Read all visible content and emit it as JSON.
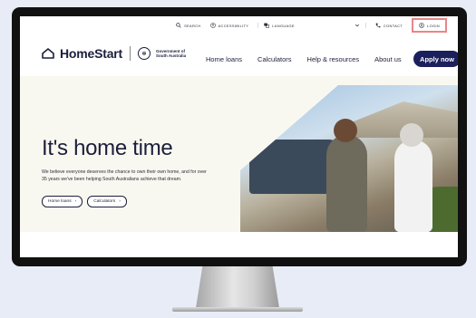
{
  "utility": {
    "search": "SEARCH",
    "accessibility": "ACCESSIBILITY",
    "language": "LANGUAGE",
    "contact": "CONTACT",
    "login": "LOGIN"
  },
  "brand": {
    "name": "HomeStart",
    "gov_line1": "Government of",
    "gov_line2": "South Australia"
  },
  "nav": {
    "items": [
      "Home loans",
      "Calculators",
      "Help & resources",
      "About us"
    ],
    "cta": "Apply now"
  },
  "hero": {
    "title": "It's home time",
    "body": "We believe everyone deserves the chance to own their own home, and for over 35 years we've been helping South Australians achieve that dream.",
    "buttons": [
      "Home loans",
      "Calculators"
    ]
  },
  "colors": {
    "navy": "#1b1f5c",
    "highlight": "#e8868a",
    "background": "#e8ecf7"
  }
}
